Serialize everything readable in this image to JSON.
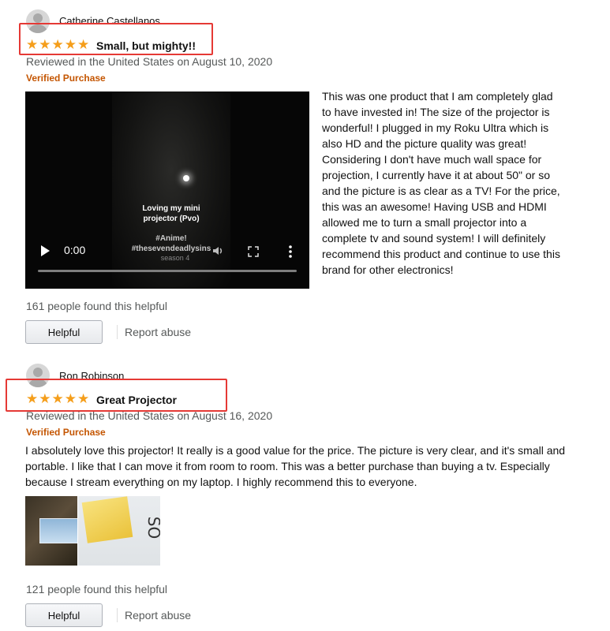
{
  "reviews": [
    {
      "reviewer": "Catherine Castellanos",
      "stars": 5,
      "title": "Small, but mighty!!",
      "meta": "Reviewed in the United States on August 10, 2020",
      "verified": "Verified Purchase",
      "video": {
        "caption_line1": "Loving my mini",
        "caption_line2": "projector (Pvo)",
        "tag_line1": "#Anime!",
        "tag_line2": "#thesevendeadlysins",
        "tag_line3": "season 4",
        "time": "0:00"
      },
      "body": " This was one product that I am completely glad to have invested in! The size of the projector is wonderful! I plugged in my Roku Ultra which is also HD and the picture quality was great! Considering I don't have much wall space for projection, I currently have it at about 50\" or so and the picture is as clear as a TV! For the price, this was an awesome! Having USB and HDMI allowed me to turn a small projector into a complete tv and sound system! I will definitely recommend this product and continue to use this brand for other electronics!",
      "helpful_count": "161 people found this helpful",
      "helpful_button": "Helpful",
      "report": "Report abuse"
    },
    {
      "reviewer": "Ron Robinson",
      "stars": 5,
      "title": "Great Projector",
      "meta": "Reviewed in the United States on August 16, 2020",
      "verified": "Verified Purchase",
      "body": "I absolutely love this projector! It really is a good value for the price. The picture is very clear, and it's small and portable. I like that I can move it from room to room. This was a better purchase than buying a tv. Especially because I stream everything on my laptop. I highly recommend this to everyone.",
      "image2_label": "SO",
      "helpful_count": "121 people found this helpful",
      "helpful_button": "Helpful",
      "report": "Report abuse"
    }
  ],
  "colors": {
    "star": "#f59e1b",
    "highlight": "#e53935",
    "verified": "#c45500",
    "muted": "#565959"
  }
}
